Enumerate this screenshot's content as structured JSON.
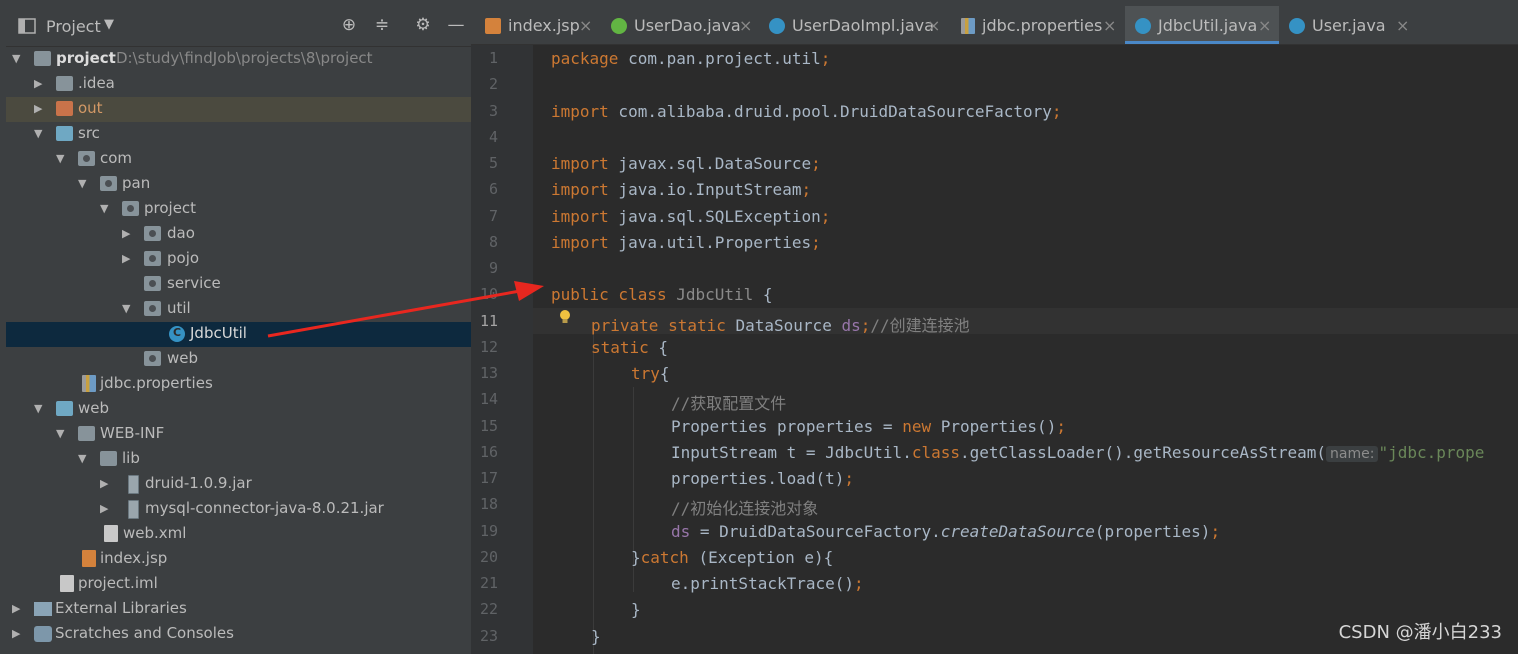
{
  "project_panel": {
    "title": "Project",
    "tree": [
      {
        "label": "project",
        "path": "D:\\study\\findJob\\projects\\8\\project"
      },
      {
        "label": ".idea"
      },
      {
        "label": "out"
      },
      {
        "label": "src"
      },
      {
        "label": "com"
      },
      {
        "label": "pan"
      },
      {
        "label": "project"
      },
      {
        "label": "dao"
      },
      {
        "label": "pojo"
      },
      {
        "label": "service"
      },
      {
        "label": "util"
      },
      {
        "label": "JdbcUtil"
      },
      {
        "label": "web"
      },
      {
        "label": "jdbc.properties"
      },
      {
        "label": "web"
      },
      {
        "label": "WEB-INF"
      },
      {
        "label": "lib"
      },
      {
        "label": "druid-1.0.9.jar"
      },
      {
        "label": "mysql-connector-java-8.0.21.jar"
      },
      {
        "label": "web.xml"
      },
      {
        "label": "index.jsp"
      },
      {
        "label": "project.iml"
      },
      {
        "label": "External Libraries"
      },
      {
        "label": "Scratches and Consoles"
      }
    ]
  },
  "tabs": [
    {
      "label": "index.jsp"
    },
    {
      "label": "UserDao.java"
    },
    {
      "label": "UserDaoImpl.java"
    },
    {
      "label": "jdbc.properties"
    },
    {
      "label": "JdbcUtil.java",
      "active": true
    },
    {
      "label": "User.java"
    }
  ],
  "editor": {
    "current_line": "11",
    "line_numbers": [
      "1",
      "2",
      "3",
      "4",
      "5",
      "6",
      "7",
      "8",
      "9",
      "10",
      "11",
      "12",
      "13",
      "14",
      "15",
      "16",
      "17",
      "18",
      "19",
      "20",
      "21",
      "22",
      "23"
    ],
    "tokens": {
      "l1_kw": "package",
      "l1_rest": " com.pan.project.util",
      "l1_semi": ";",
      "l3_kw": "import",
      "l3_rest": " com.alibaba.druid.pool.DruidDataSourceFactory",
      "l3_semi": ";",
      "l5_kw": "import",
      "l5_rest": " javax.sql.DataSource",
      "l5_semi": ";",
      "l6_kw": "import",
      "l6_rest": " java.io.InputStream",
      "l6_semi": ";",
      "l7_kw": "import",
      "l7_rest": " java.sql.SQLException",
      "l7_semi": ";",
      "l8_kw": "import",
      "l8_rest": " java.util.Properties",
      "l8_semi": ";",
      "l10_kw": "public class",
      "l10_name": " JdbcUtil",
      "l10_rest": " {",
      "l11_kw": "private static",
      "l11_type": " DataSource ",
      "l11_fld": "ds",
      "l11_semi": ";",
      "l11_cmt": "//创建连接池",
      "l12_kw": "static",
      "l12_rest": " {",
      "l13_kw": "try",
      "l13_rest": "{",
      "l14_cmt": "//获取配置文件",
      "l15_a": "Properties properties = ",
      "l15_kw": "new",
      "l15_b": " Properties()",
      "l15_semi": ";",
      "l16_a": "InputStream t = JdbcUtil.",
      "l16_kw": "class",
      "l16_b": ".getClassLoader().getResourceAsStream(",
      "l16_hint": "name:",
      "l16_str": "\"jdbc.prope",
      "l17_a": "properties.load(t)",
      "l17_semi": ";",
      "l18_cmt": "//初始化连接池对象",
      "l19_fld": "ds",
      "l19_a": " = DruidDataSourceFactory.",
      "l19_it": "createDataSource",
      "l19_b": "(properties)",
      "l19_semi": ";",
      "l20_a": "}",
      "l20_kw": "catch",
      "l20_b": " (Exception e){",
      "l21_a": "e.printStackTrace()",
      "l21_semi": ";",
      "l22_a": "}",
      "l23_a": "}"
    }
  },
  "watermark": "CSDN @潘小白233",
  "colors": {
    "keyword": "#cc7832",
    "field": "#9876aa",
    "comment": "#808080",
    "string": "#6a8759",
    "annotation_arrow": "#e8271f"
  }
}
